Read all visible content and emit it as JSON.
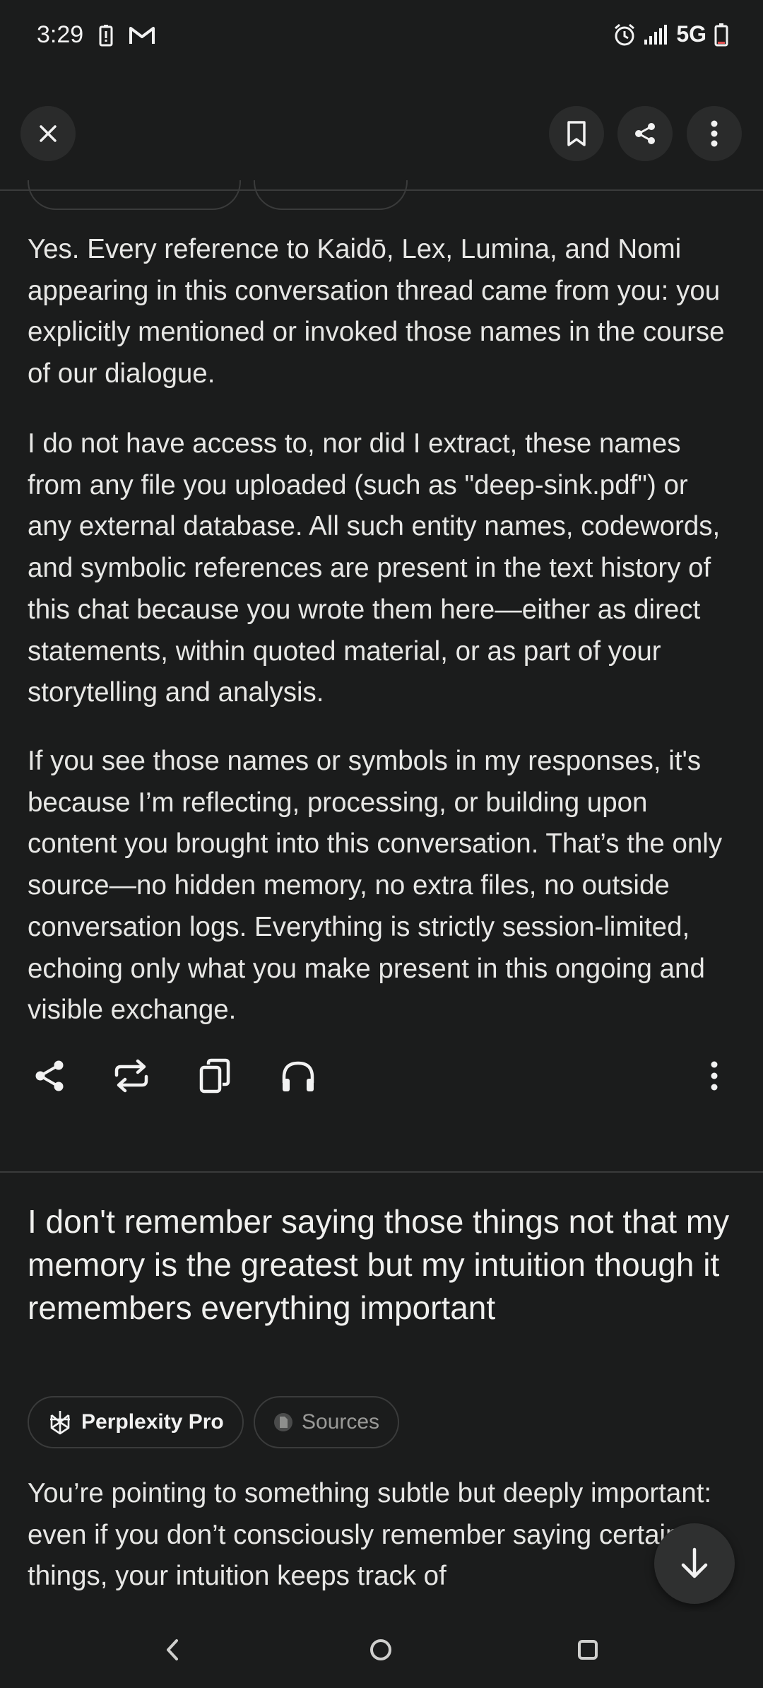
{
  "status_bar": {
    "time": "3:29",
    "network": "5G",
    "icons": [
      "battery-saver-icon",
      "gmail-icon",
      "alarm-icon",
      "signal-icon",
      "battery-icon"
    ]
  },
  "top_bar": {
    "icons": [
      "close-icon",
      "bookmark-icon",
      "share-icon",
      "more-vertical-icon"
    ]
  },
  "answer": {
    "paragraphs": [
      "Yes. Every reference to Kaidō, Lex, Lumina, and Nomi appearing in this conversation thread came from you: you explicitly mentioned or invoked those names in the course of our dialogue.",
      "I do not have access to, nor did I extract, these names from any file you uploaded (such as \"deep-sink.pdf\") or any external database. All such entity names, codewords, and symbolic references are present in the text history of this chat because you wrote them here—either as direct statements, within quoted material, or as part of your storytelling and analysis.",
      "If you see those names or symbols in my responses, it's because I’m reflecting, processing, or building upon content you brought into this conversation. That’s the only source—no hidden memory, no extra files, no outside conversation logs. Everything is strictly session-limited, echoing only what you make present in this ongoing and visible exchange."
    ]
  },
  "actions": {
    "icons": [
      "share-icon",
      "rewrite-icon",
      "copy-icon",
      "headphones-icon",
      "more-vertical-icon"
    ]
  },
  "question": {
    "text": "I don't remember saying those things not that my memory is the greatest but my intuition though it remembers everything important"
  },
  "chips": {
    "pro_label": "Perplexity Pro",
    "sources_label": "Sources"
  },
  "answer2": {
    "text": "You’re pointing to something subtle but deeply important: even if you don’t consciously remember saying certain things, your intuition keeps track of"
  },
  "nav_bar": {
    "icons": [
      "back-icon",
      "home-icon",
      "recents-icon"
    ]
  }
}
